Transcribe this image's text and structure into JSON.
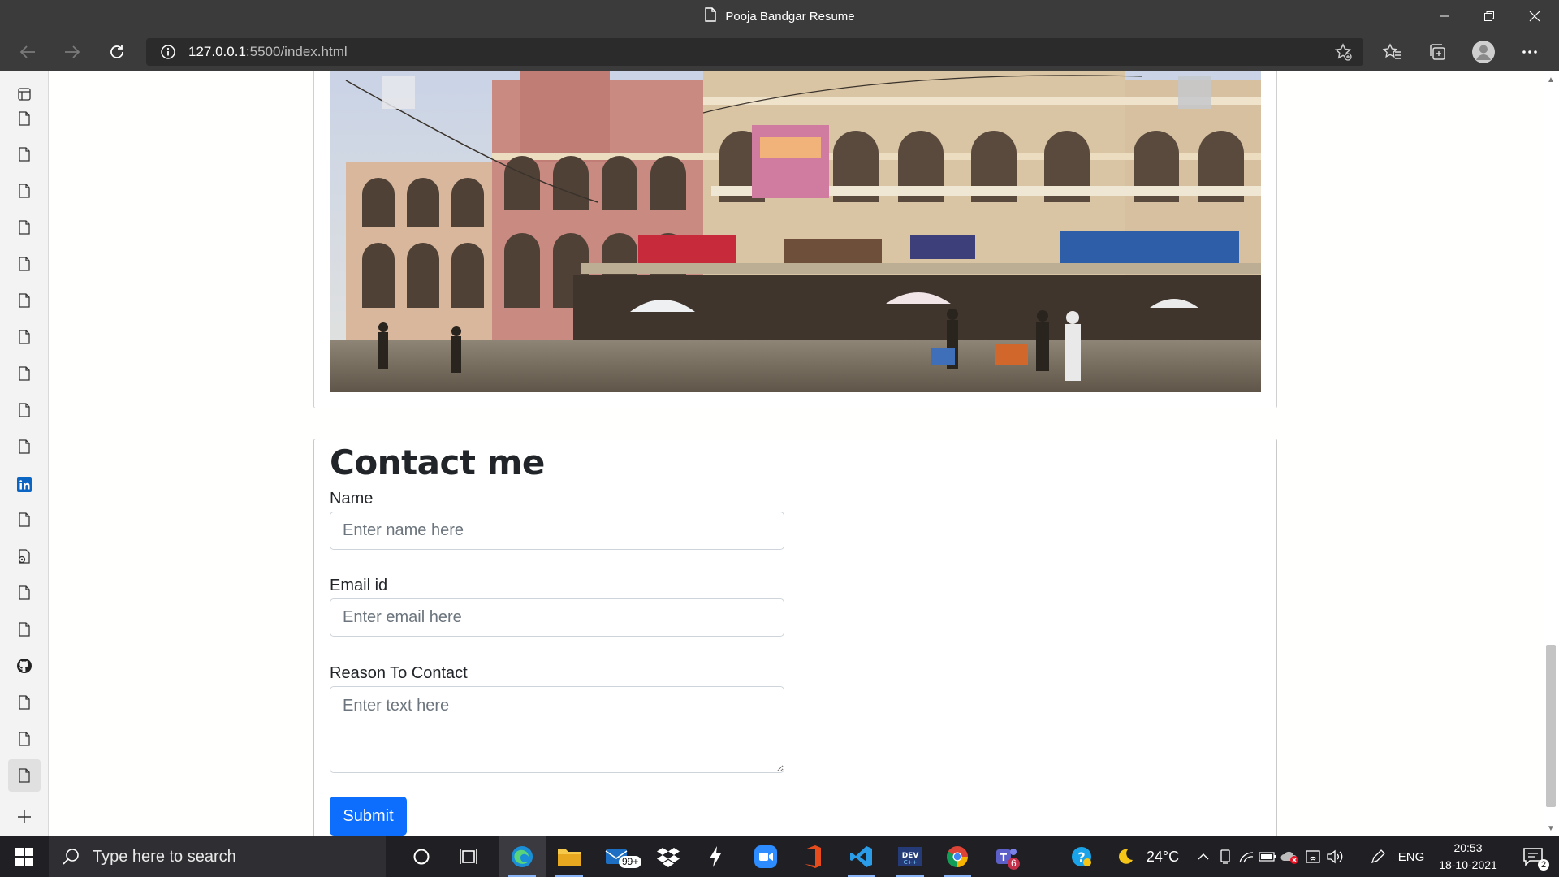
{
  "window": {
    "title": "Pooja Bandgar Resume"
  },
  "navbar": {
    "url_host": "127.0.0.1",
    "url_path": ":5500/index.html"
  },
  "tabs": {
    "icons": [
      "page-icon",
      "page-icon",
      "page-icon",
      "page-icon",
      "page-icon",
      "page-icon",
      "page-icon",
      "page-icon",
      "page-icon",
      "page-icon",
      "page-icon",
      "linkedin-icon",
      "page-icon",
      "page-settings-icon",
      "page-icon",
      "page-icon",
      "github-icon",
      "page-icon",
      "page-icon",
      "page-icon"
    ],
    "new_tab_label": "+"
  },
  "contact": {
    "heading": "Contact me",
    "name_label": "Name",
    "name_placeholder": "Enter name here",
    "email_label": "Email id",
    "email_placeholder": "Enter email here",
    "reason_label": "Reason To Contact",
    "reason_placeholder": "Enter text here",
    "submit_label": "Submit"
  },
  "taskbar": {
    "search_placeholder": "Type here to search",
    "mail_badge": "99+",
    "teams_badge": "6",
    "weather": "24°C",
    "language": "ENG",
    "time": "20:53",
    "date": "18-10-2021"
  },
  "colors": {
    "chrome_dark": "#3b3b3b",
    "taskbar": "#1f1f24",
    "primary_button": "#0d6efd",
    "linkedin": "#0a66c2"
  }
}
